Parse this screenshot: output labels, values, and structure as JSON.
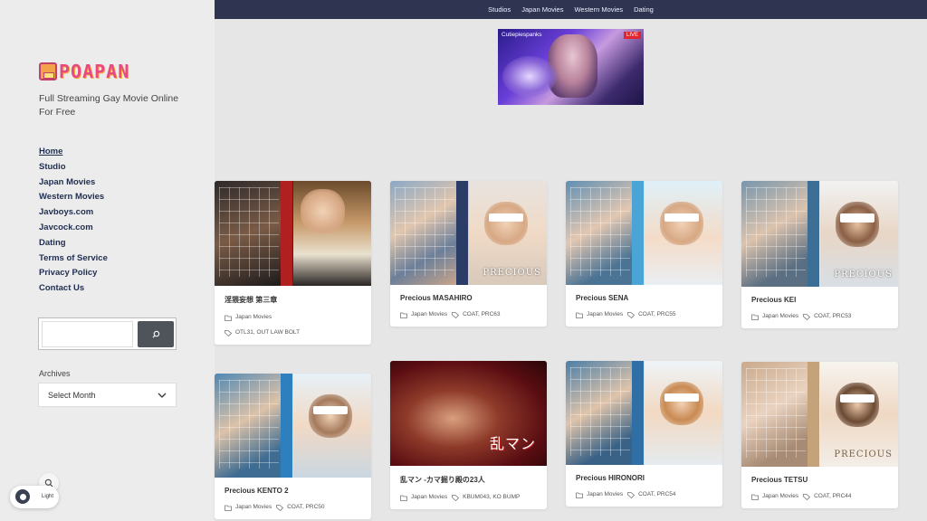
{
  "site": {
    "logo_text": "POAPAN",
    "tagline": "Full Streaming Gay Movie Online For Free"
  },
  "sidebar": {
    "nav": [
      {
        "label": "Home",
        "active": true
      },
      {
        "label": "Studio"
      },
      {
        "label": "Japan Movies"
      },
      {
        "label": "Western Movies"
      },
      {
        "label": "Javboys.com"
      },
      {
        "label": "Javcock.com"
      },
      {
        "label": "Dating"
      },
      {
        "label": "Terms of Service"
      },
      {
        "label": "Privacy Policy"
      },
      {
        "label": "Contact Us"
      }
    ],
    "search": {
      "placeholder": ""
    },
    "archives_label": "Archives",
    "archives_select": "Select Month"
  },
  "theme_toggle": {
    "label": "Light"
  },
  "topnav": [
    "Studios",
    "Japan Movies",
    "Western Movies",
    "Dating"
  ],
  "live_banner": {
    "name": "Cutiepiespanks",
    "badge": "LIVE"
  },
  "cards": [
    {
      "title": "淫猥妄想 第三章",
      "category": "Japan Movies",
      "tags": "OTL31, OUT LAW BOLT"
    },
    {
      "title": "Precious MASAHIRO",
      "category": "Japan Movies",
      "tags": "COAT, PRC63"
    },
    {
      "title": "Precious SENA",
      "category": "Japan Movies",
      "tags": "COAT, PRC55"
    },
    {
      "title": "Precious KEI",
      "category": "Japan Movies",
      "tags": "COAT, PRC53"
    },
    {
      "title": "Precious KENTO 2",
      "category": "Japan Movies",
      "tags": "COAT, PRC50"
    },
    {
      "title": "乱マン -カマ掘り殿の23人",
      "category": "Japan Movies",
      "tags": "KBUM043, KO BUMP"
    },
    {
      "title": "Precious HIRONORI",
      "category": "Japan Movies",
      "tags": "COAT, PRC54"
    },
    {
      "title": "Precious TETSU",
      "category": "Japan Movies",
      "tags": "COAT, PRC44"
    }
  ],
  "colors": {
    "topbar": "#2f3550",
    "sidebar_bg": "#ececec",
    "page_bg": "#e6e6e6",
    "link": "#1f2d4f",
    "search_button": "#4f545a"
  }
}
